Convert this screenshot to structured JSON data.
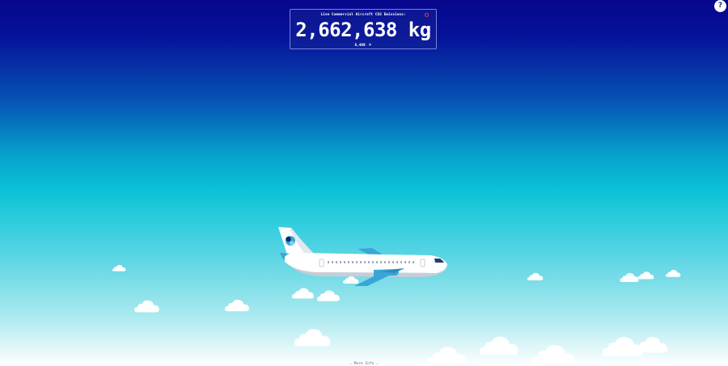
{
  "panel": {
    "title": "Live Commercial Aircraft CO2 Emissions:",
    "value": "2,662,638",
    "unit": "kg",
    "flights_count": "8,489"
  },
  "help": {
    "label": "?"
  },
  "footer": {
    "chevron_left": "⌄",
    "more_info_label": "More Info",
    "chevron_right": "⌄"
  },
  "colors": {
    "sky_top": "#07078c",
    "sky_mid": "#0bc2d6",
    "sky_bottom": "#ffffff",
    "live_indicator": "#e23a4f",
    "plane_accent": "#3aa5d8"
  },
  "icons": {
    "help": "question-mark-icon",
    "live": "live-indicator-icon",
    "flight": "airplane-icon",
    "main_illustration": "airplane-illustration"
  }
}
